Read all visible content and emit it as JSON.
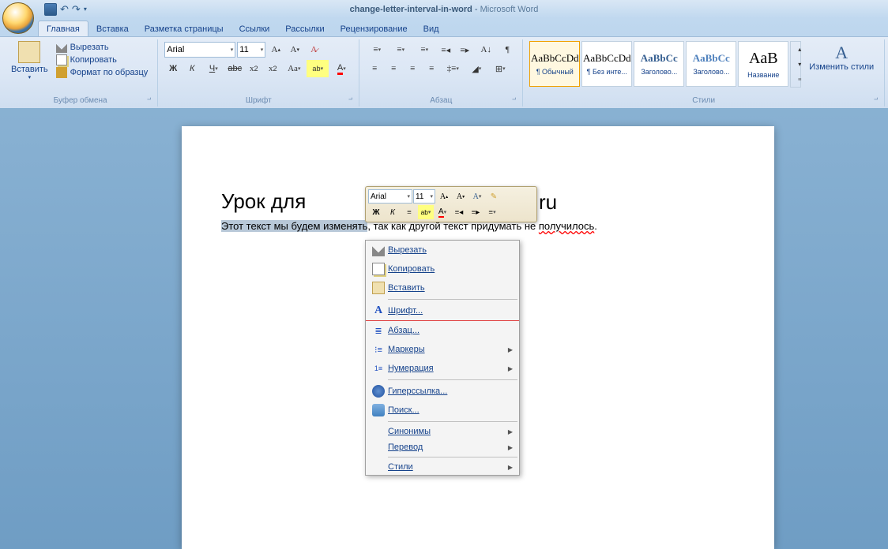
{
  "title": {
    "doc": "change-letter-interval-in-word",
    "app": "Microsoft Word",
    "sep": "  -  "
  },
  "tabs": [
    "Главная",
    "Вставка",
    "Разметка страницы",
    "Ссылки",
    "Рассылки",
    "Рецензирование",
    "Вид"
  ],
  "groups": {
    "clipboard": {
      "label": "Буфер обмена",
      "paste": "Вставить",
      "cut": "Вырезать",
      "copy": "Копировать",
      "format": "Формат по образцу"
    },
    "font": {
      "label": "Шрифт",
      "name": "Arial",
      "size": "11"
    },
    "para": {
      "label": "Абзац"
    },
    "styles": {
      "label": "Стили",
      "items": [
        {
          "sample": "AaBbCcDd",
          "name": "¶ Обычный"
        },
        {
          "sample": "AaBbCcDd",
          "name": "¶ Без инте..."
        },
        {
          "sample": "AaBbCc",
          "name": "Заголово..."
        },
        {
          "sample": "AaBbCc",
          "name": "Заголово..."
        },
        {
          "sample": "AaB",
          "name": "Название"
        }
      ],
      "change": "Изменить стили"
    }
  },
  "doc": {
    "heading_pre": "Урок для",
    "heading_ru": "ru",
    "body_sel": "Этот текст мы будем изменять",
    "body_rest": ", так как другой текст придумать не ",
    "body_wavy": "получилось",
    "body_dot": "."
  },
  "mini": {
    "font": "Arial",
    "size": "11"
  },
  "context": {
    "cut": "Вырезать",
    "copy": "Копировать",
    "paste": "Вставить",
    "font": "Шрифт...",
    "para": "Абзац...",
    "bullets": "Маркеры",
    "numbering": "Нумерация",
    "hyperlink": "Гиперссылка...",
    "search": "Поиск...",
    "synonyms": "Синонимы",
    "translate": "Перевод",
    "styles": "Стили"
  }
}
